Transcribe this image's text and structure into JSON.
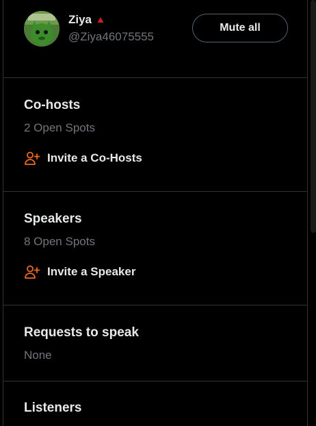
{
  "host": {
    "name": "Ziya",
    "handle": "@Ziya46075555",
    "avatar_icon": "avatar-icon",
    "badge_icon": "host-triangle-icon",
    "badge_color": "#f4212e"
  },
  "mute_all_label": "Mute all",
  "sections": {
    "cohosts": {
      "title": "Co-hosts",
      "subtitle": "2 Open Spots",
      "invite_label": "Invite a Co-Hosts",
      "invite_icon": "add-person-icon"
    },
    "speakers": {
      "title": "Speakers",
      "subtitle": "8 Open Spots",
      "invite_label": "Invite a Speaker",
      "invite_icon": "add-person-icon"
    },
    "requests": {
      "title": "Requests to speak",
      "subtitle": "None"
    },
    "listeners": {
      "title": "Listeners"
    }
  },
  "colors": {
    "accent": "#f06a1f",
    "background": "#000000",
    "divider": "#2f3336",
    "secondary_text": "#71767b"
  }
}
